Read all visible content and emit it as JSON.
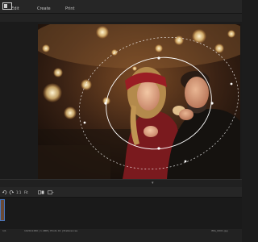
{
  "menu": {
    "items": [
      "Edit",
      "Create",
      "Print"
    ]
  },
  "toolbar": {
    "export_icon": "export-icon"
  },
  "timeline": {
    "zoom_label": "1:1",
    "fit_label": "Fit",
    "compare_label": "Compare",
    "view_label": "View"
  },
  "status": {
    "left": "1/1",
    "middle": "1920x1280 | 1.4MB | Photo 01 | Preferences",
    "right": "IMG_0001.jpg"
  },
  "colors": {
    "accent": "#4a78c0",
    "panel": "#1c1c1c",
    "bar": "#262626"
  }
}
